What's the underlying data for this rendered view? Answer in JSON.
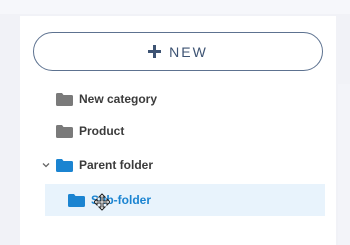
{
  "toolbar": {
    "new_label": "NEW"
  },
  "tree": [
    {
      "label": "New category",
      "icon": "folder-icon",
      "color": "#7a7a7a"
    },
    {
      "label": "Product",
      "icon": "folder-icon",
      "color": "#7a7a7a"
    },
    {
      "label": "Parent folder",
      "icon": "folder-icon",
      "color": "#1b84d1",
      "expanded": true
    },
    {
      "label": "Sub-folder",
      "icon": "folder-icon",
      "color": "#1b84d1",
      "selected": true
    }
  ],
  "colors": {
    "accent": "#1b84d1",
    "selected_bg": "#e8f3fc",
    "button_border": "#5d7290"
  }
}
